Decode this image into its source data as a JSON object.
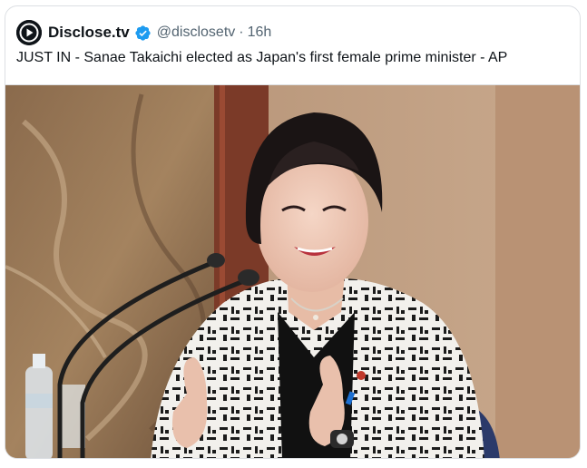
{
  "tweet": {
    "author_name": "Disclose.tv",
    "handle": "@disclosetv",
    "separator": "·",
    "time_ago": "16h",
    "text": "JUST IN - Sanae Takaichi elected as Japan's first female prime minister - AP",
    "verified": true
  },
  "icons": {
    "avatar": "play-logo-icon",
    "verified": "verified-badge-icon"
  },
  "colors": {
    "text_primary": "#0f1419",
    "text_secondary": "#536471",
    "verified_blue": "#1d9bf0",
    "border": "#dcdfe3"
  },
  "media": {
    "description_alt": "Photo"
  }
}
